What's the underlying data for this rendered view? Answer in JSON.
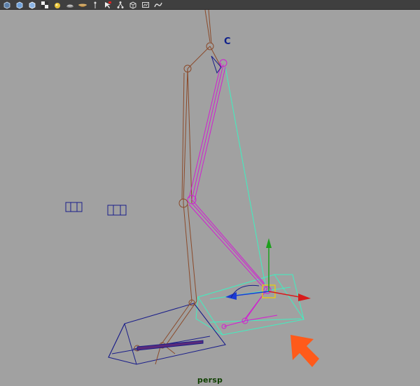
{
  "viewport": {
    "camera_label": "persp",
    "locator_label": "C"
  },
  "toolbar": {
    "icons": [
      "wireframe-cube-icon",
      "smooth-shade-cube-icon",
      "textured-cube-icon",
      "checker-icon",
      "light-sphere-icon",
      "flat-light-icon",
      "bowl-light-icon",
      "camera-icon",
      "select-joint-icon",
      "hierarchy-icon",
      "isolate-icon",
      "render-icon",
      "snapshot-icon"
    ]
  },
  "colors": {
    "background": "#a1a1a1",
    "skeleton": "#8b4a2a",
    "ik_chain": "#d11fd1",
    "selection": "#3ff0c0",
    "control_box": "#1a1e8a",
    "arrow_annotation": "#ff5a1a",
    "manip_x": "#d81b1b",
    "manip_y": "#1ca01c",
    "manip_z": "#1a3ad6"
  }
}
